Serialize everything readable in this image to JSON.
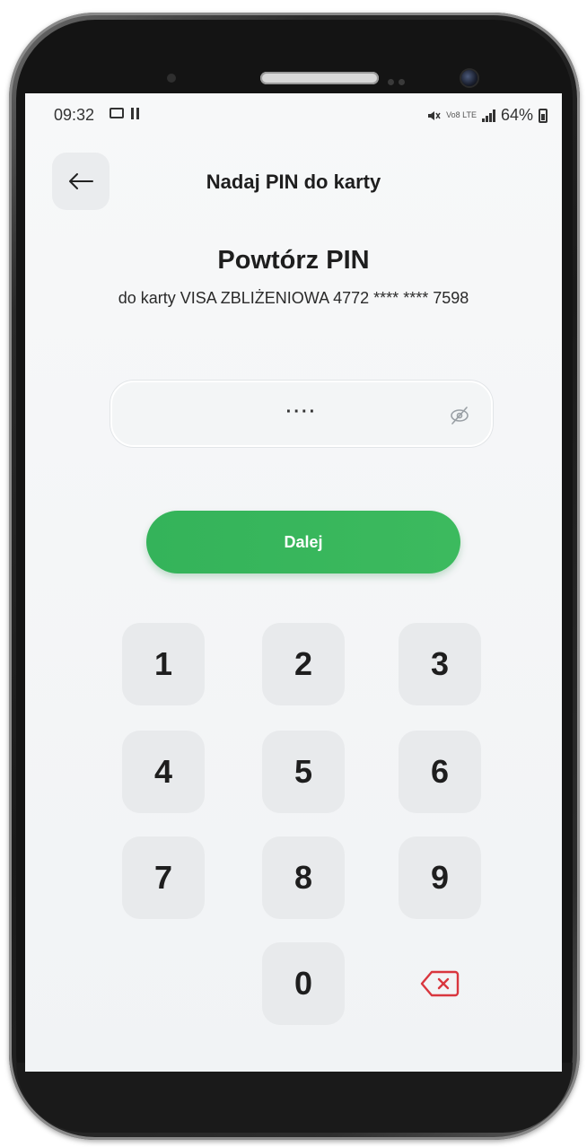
{
  "status_bar": {
    "time": "09:32",
    "indicators": "Vo8 LTE",
    "battery": "64%"
  },
  "header": {
    "title": "Nadaj PIN do karty",
    "back_icon": "arrow-left-icon"
  },
  "pin_section": {
    "title": "Powtórz PIN",
    "subtitle": "do karty VISA ZBLIŻENIOWA 4772 **** **** 7598"
  },
  "pin_input": {
    "value": "····",
    "visibility_icon": "eye-off-icon"
  },
  "next_button": {
    "label": "Dalej"
  },
  "keypad": {
    "keys": [
      "1",
      "2",
      "3",
      "4",
      "5",
      "6",
      "7",
      "8",
      "9",
      "0"
    ],
    "delete_icon": "backspace-icon"
  },
  "colors": {
    "accent": "#34b35a",
    "delete_red": "#d9363e",
    "key_bg": "#e8eaec"
  }
}
